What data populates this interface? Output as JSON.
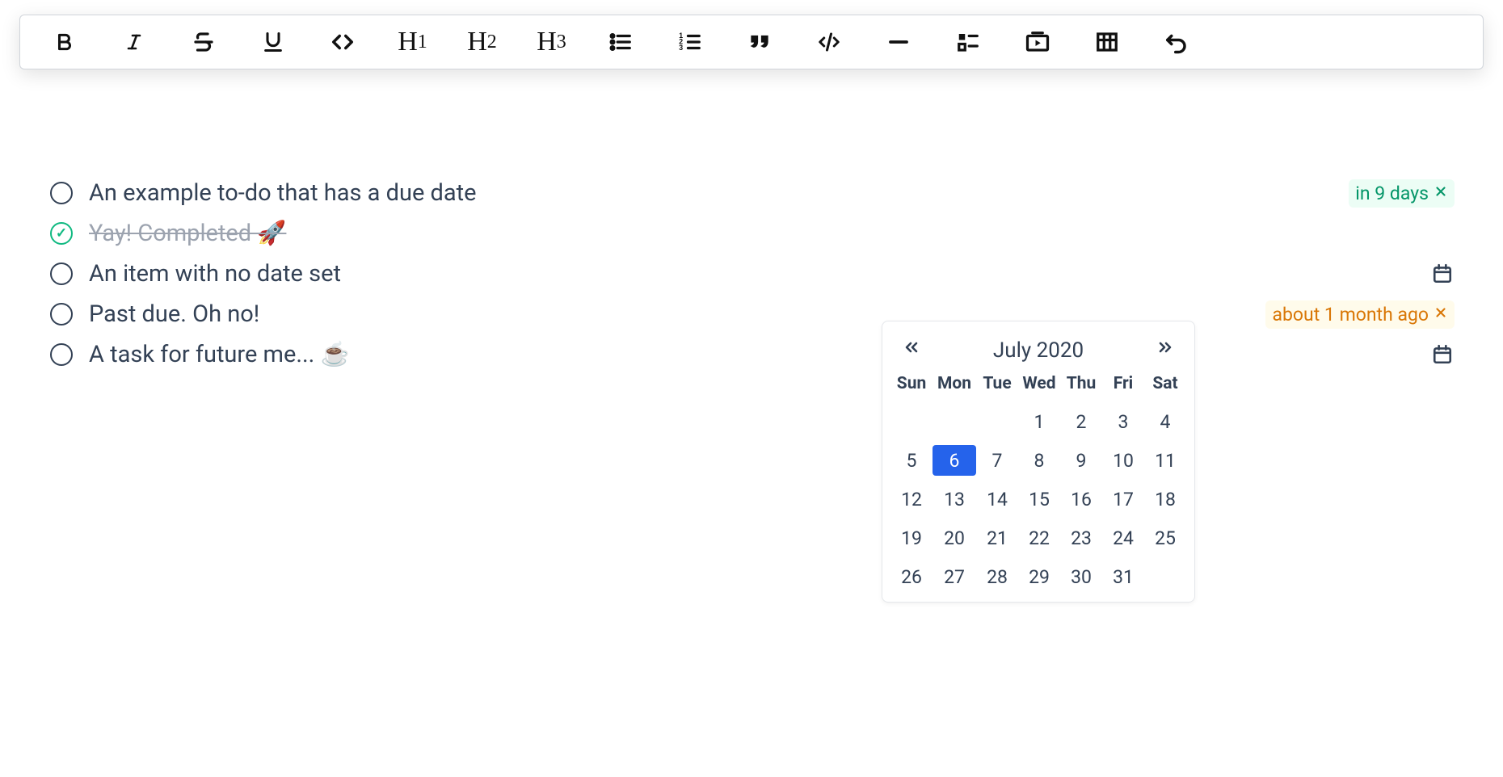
{
  "toolbar": {
    "h1": "H",
    "h1s": "1",
    "h2": "H",
    "h2s": "2",
    "h3": "H",
    "h3s": "3"
  },
  "todos": [
    {
      "text": "An example to-do that has a due date",
      "done": false,
      "badge": {
        "text": "in 9 days",
        "kind": "green"
      }
    },
    {
      "text": "Yay! Completed 🚀",
      "done": true
    },
    {
      "text": "An item with no date set",
      "done": false,
      "showCalIcon": true
    },
    {
      "text": "Past due. Oh no!",
      "done": false,
      "badge": {
        "text": "about 1 month ago",
        "kind": "amber"
      }
    },
    {
      "text": "A task for future me... ☕",
      "done": false,
      "showCalIcon": true
    }
  ],
  "calendar": {
    "monthLabel": "July 2020",
    "dow": [
      "Sun",
      "Mon",
      "Tue",
      "Wed",
      "Thu",
      "Fri",
      "Sat"
    ],
    "leadingBlanks": 3,
    "daysInMonth": 31,
    "selectedDay": 6
  }
}
